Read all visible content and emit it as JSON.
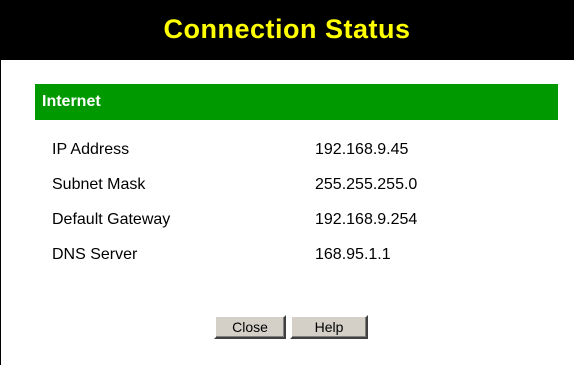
{
  "header": {
    "title": "Connection Status",
    "background": "#000000",
    "title_color": "#ffff00"
  },
  "section": {
    "title": "Internet",
    "background": "#009900"
  },
  "fields": [
    {
      "label": "IP Address",
      "value": "192.168.9.45"
    },
    {
      "label": "Subnet Mask",
      "value": "255.255.255.0"
    },
    {
      "label": "Default Gateway",
      "value": "192.168.9.254"
    },
    {
      "label": "DNS Server",
      "value": "168.95.1.1"
    }
  ],
  "buttons": {
    "close_label": "Close",
    "help_label": "Help"
  }
}
